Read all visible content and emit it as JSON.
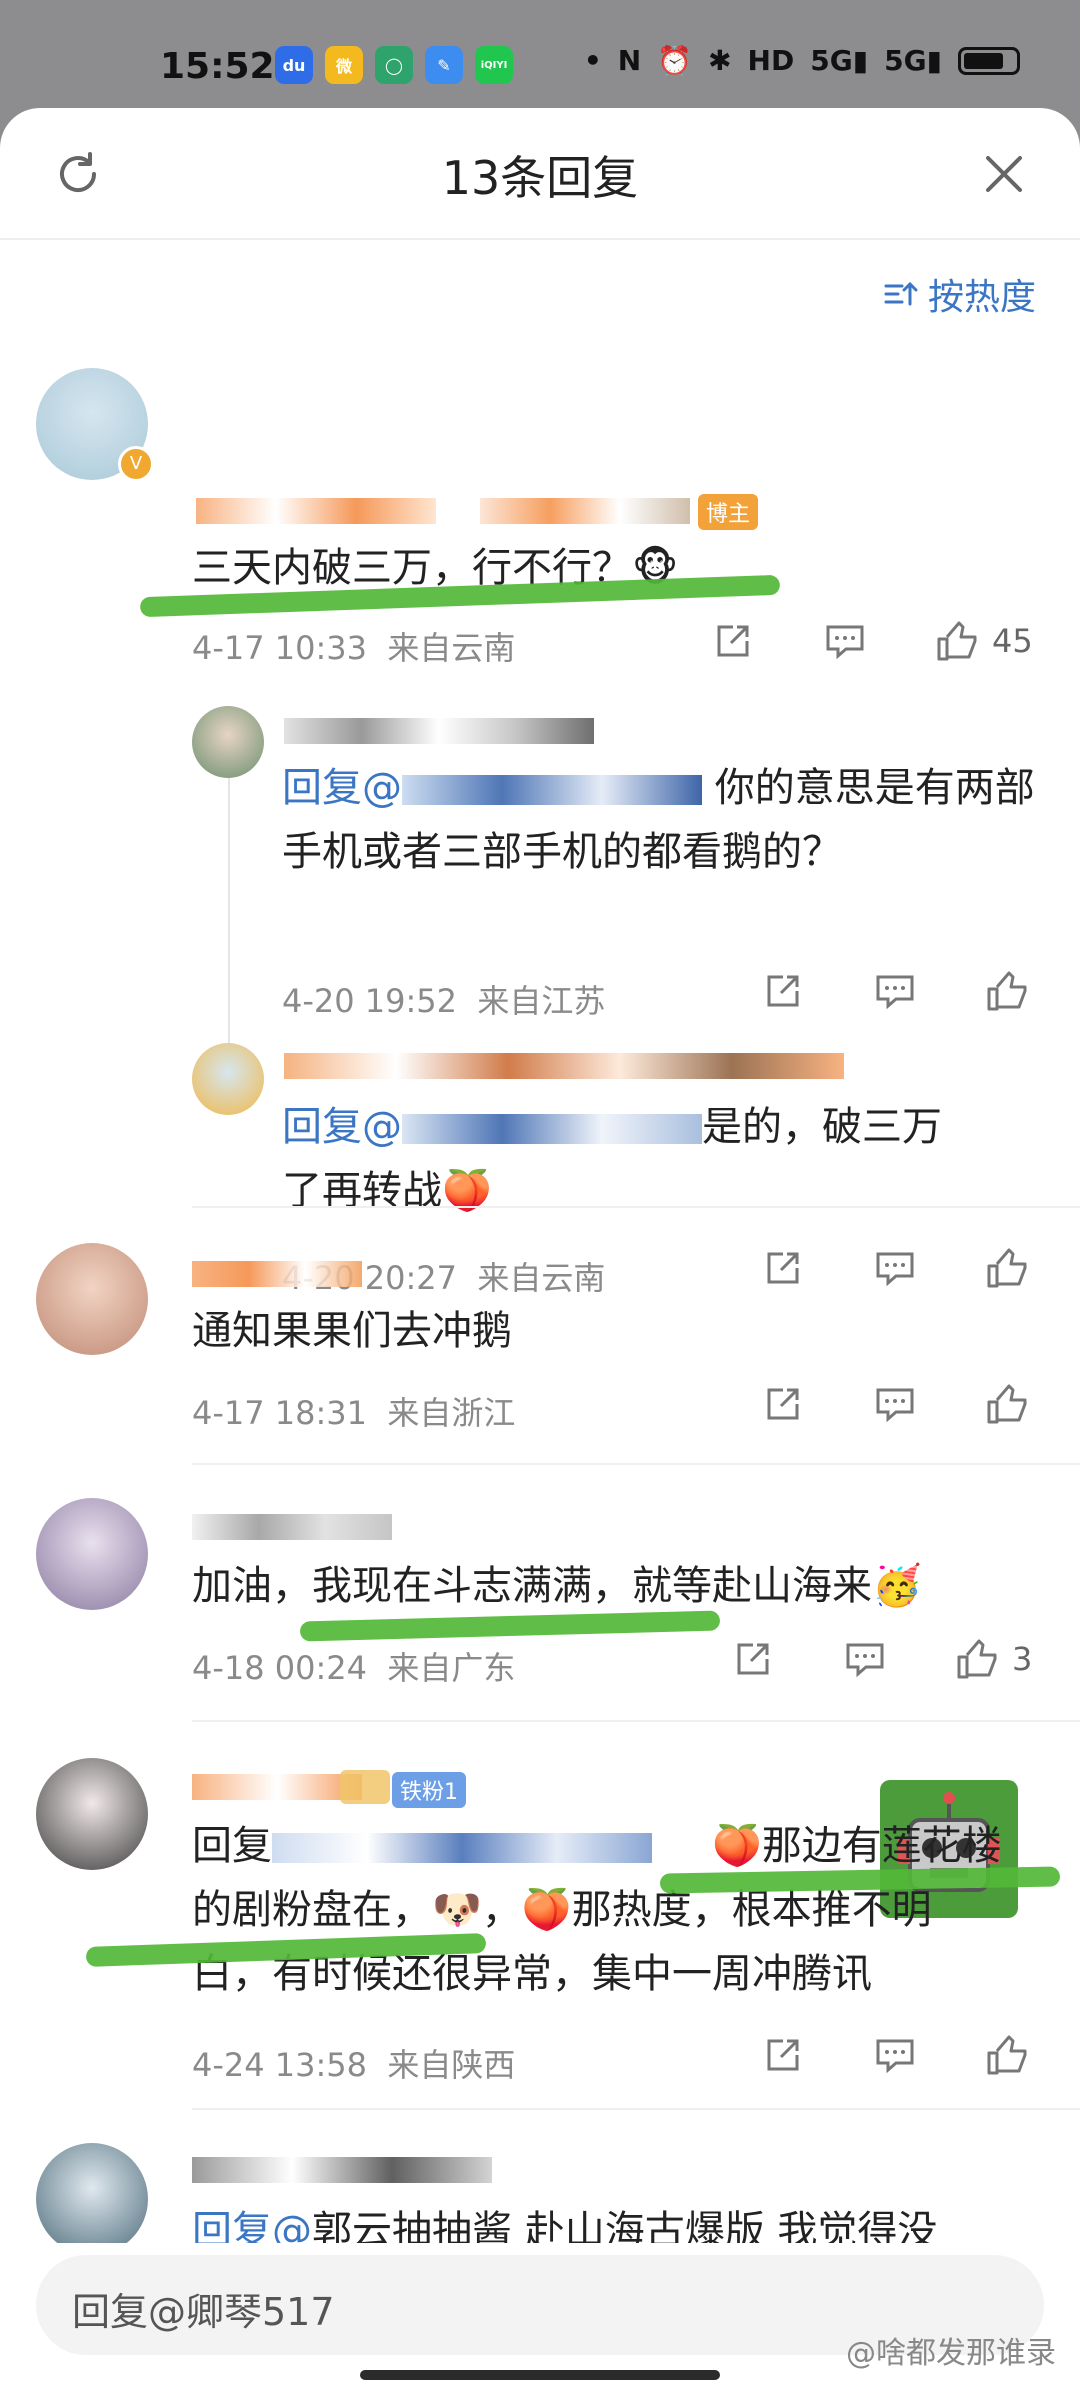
{
  "status_bar": {
    "time": "15:52",
    "apps": [
      {
        "icon": "baidu-icon",
        "label": "du",
        "color": "#2f6de8"
      },
      {
        "icon": "weibo-icon",
        "label": "微",
        "color": "#f4b91f"
      },
      {
        "icon": "chat-icon",
        "label": "◯",
        "color": "#2fa36c"
      },
      {
        "icon": "feather-icon",
        "label": "✎",
        "color": "#3d8cf0"
      },
      {
        "icon": "iqiyi-icon",
        "label": "iQIYI",
        "color": "#21c64f"
      }
    ],
    "dot": "•",
    "network": "HD",
    "signal_1": "5G",
    "signal_2": "5G",
    "battery_level": 0.78
  },
  "header": {
    "title": "13条回复",
    "sort_label": "按热度"
  },
  "comments": [
    {
      "badge": "博主",
      "text": "三天内破三万，行不行？",
      "emoji": "🐵",
      "time": "4-17 10:33",
      "location": "来自云南",
      "likes": "45"
    },
    {
      "reply_prefix": "回复@",
      "text": "你的意思是有两部手机或者三部手机的都看鹅的？",
      "time": "4-20 19:52",
      "location": "来自江苏"
    },
    {
      "reply_prefix": "回复@",
      "text_a": "是的，破三万",
      "text_b": "了再转战",
      "emoji": "🍑",
      "time": "4-20 20:27",
      "location": "来自云南"
    },
    {
      "text": "通知果果们去冲鹅",
      "time": "4-17 18:31",
      "location": "来自浙江"
    },
    {
      "text": "加油，我现在斗志满满，就等赴山海来",
      "emoji": "🥳",
      "time": "4-18 00:24",
      "location": "来自广东",
      "likes": "3"
    },
    {
      "badge": "铁粉1",
      "reply_prefix": "回复",
      "text_a": "那边有莲花楼",
      "text_b": "的剧粉盘在，",
      "emoji_a": "🍑",
      "emoji_dog": "🐶",
      "emoji_b": "🍑",
      "text_c": "那热度，根本推不明",
      "text_d": "白，有时候还很异常，集中一周冲腾讯",
      "time": "4-24 13:58",
      "location": "来自陕西"
    },
    {
      "reply_prefix": "回复@",
      "text": "郭云抽抽酱 赴山海古爆版 我觉得没"
    }
  ],
  "input": {
    "placeholder": "回复@卿琴517"
  },
  "watermark": "@啥都发那谁录"
}
